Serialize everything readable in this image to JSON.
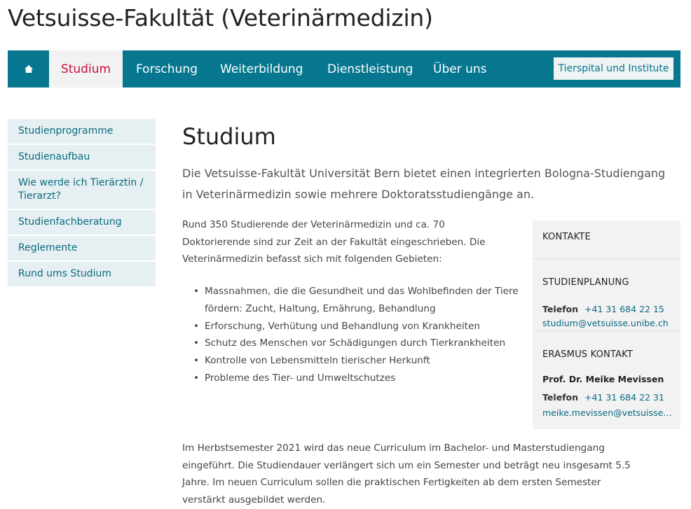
{
  "site": {
    "title": "Vetsuisse-Fakultät (Veterinärmedizin)"
  },
  "nav": {
    "home_icon": "home-icon",
    "items": [
      {
        "label": "Studium",
        "active": true
      },
      {
        "label": "Forschung",
        "active": false
      },
      {
        "label": "Weiterbildung",
        "active": false
      },
      {
        "label": "Dienstleistung",
        "active": false
      },
      {
        "label": "Über uns",
        "active": false
      }
    ],
    "cta_label": "Tierspital und Institute"
  },
  "sidebar": {
    "items": [
      {
        "label": "Studienprogramme"
      },
      {
        "label": "Studienaufbau"
      },
      {
        "label": "Wie werde ich Tierärztin / Tierarzt?"
      },
      {
        "label": "Studienfachberatung"
      },
      {
        "label": "Reglemente"
      },
      {
        "label": "Rund ums Studium"
      }
    ]
  },
  "main": {
    "title": "Studium",
    "lead": "Die Vetsuisse-Fakultät Universität Bern bietet einen integrierten Bologna-Studiengang in Veterinärmedizin sowie mehrere Doktoratsstudiengänge an.",
    "intro": "Rund 350 Studierende der Veterinärmedizin und ca. 70 Doktorierende sind zur Zeit an der Fakultät eingeschrieben. Die Veterinärmedizin befasst sich mit folgenden Gebieten:",
    "bullets": [
      "Massnahmen, die die Gesundheit und das Wohlbefinden der Tiere fördern: Zucht, Haltung, Ernährung, Behandlung",
      "Erforschung, Verhütung und Behandlung von Krankheiten",
      "Schutz des Menschen vor Schädigungen durch Tierkrankheiten",
      "Kontrolle von Lebensmitteln tierischer Herkunft",
      "Probleme des Tier- und Umweltschutzes"
    ],
    "paragraph2": "Im Herbstsemester 2021 wird das neue Curriculum im Bachelor- und Masterstudiengang eingeführt. Die Studiendauer verlängert sich um ein Semester und beträgt neu insgesamt 5.5 Jahre. Im neuen Curriculum sollen die praktischen Fertigkeiten ab dem ersten Semester verstärkt ausgebildet werden."
  },
  "contacts": {
    "heading": "KONTAKTE",
    "studienplanung": {
      "heading": "STUDIENPLANUNG",
      "phone_label": "Telefon",
      "phone": "+41 31 684 22 15",
      "email": "studium@vetsuisse.unibe.ch"
    },
    "erasmus": {
      "heading": "ERASMUS KONTAKT",
      "name": "Prof. Dr. Meike Mevissen",
      "phone_label": "Telefon",
      "phone": "+41 31 684 22 31",
      "email": "meike.mevissen@vetsuisse.unibe.ch"
    }
  },
  "colors": {
    "nav_bg": "#07778f",
    "active_text": "#c5113a",
    "link": "#0a6a80",
    "sidebar_bg": "#e6f0f2",
    "contact_bg": "#f2f2f2"
  }
}
